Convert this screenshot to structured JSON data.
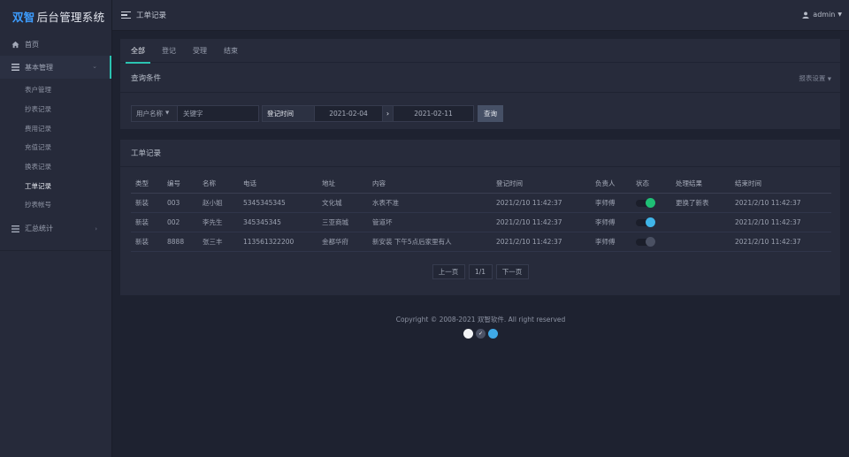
{
  "app": {
    "brand": "双智",
    "title_rest": "后台管理系统"
  },
  "sidebar": {
    "home": {
      "label": "首页",
      "icon": "home-icon"
    },
    "basic": {
      "label": "基本管理",
      "icon": "list-icon"
    },
    "sub_items": [
      {
        "label": "表户管理",
        "active": false
      },
      {
        "label": "抄表记录",
        "active": false
      },
      {
        "label": "费用记录",
        "active": false
      },
      {
        "label": "充值记录",
        "active": false
      },
      {
        "label": "换表记录",
        "active": false
      },
      {
        "label": "工单记录",
        "active": true
      },
      {
        "label": "抄表帐号",
        "active": false
      }
    ],
    "summary": {
      "label": "汇总统计",
      "icon": "list-icon"
    }
  },
  "topbar": {
    "breadcrumb": "工单记录",
    "user": "admin"
  },
  "tabs": [
    "全部",
    "登记",
    "受理",
    "结束"
  ],
  "query": {
    "title": "查询条件",
    "report_settings": "报表设置",
    "field_select": "用户名称",
    "keyword_placeholder": "关键字",
    "date_label": "登记时间",
    "date_from": "2021-02-04",
    "date_sep": "›",
    "date_to": "2021-02-11",
    "search_button": "查询"
  },
  "list": {
    "title": "工单记录",
    "columns": [
      "类型",
      "编号",
      "名称",
      "电话",
      "地址",
      "内容",
      "登记时间",
      "负责人",
      "状态",
      "处理结果",
      "结束时间"
    ],
    "rows": [
      {
        "type": "新装",
        "id": "003",
        "name": "赵小姐",
        "phone": "5345345345",
        "address": "文化城",
        "content": "水表不准",
        "reg_time": "2021/2/10 11:42:37",
        "owner": "李师傅",
        "status_color": "#1fbf75",
        "result": "更换了新表",
        "end_time": "2021/2/10 11:42:37"
      },
      {
        "type": "新装",
        "id": "002",
        "name": "李先生",
        "phone": "345345345",
        "address": "三亚商城",
        "content": "管道坏",
        "reg_time": "2021/2/10 11:42:37",
        "owner": "李师傅",
        "status_color": "#3fb5e8",
        "result": "",
        "end_time": "2021/2/10 11:42:37"
      },
      {
        "type": "新装",
        "id": "8888",
        "name": "张三丰",
        "phone": "113561322200",
        "address": "金都华府",
        "content": "新安装 下午5点后家里有人",
        "reg_time": "2021/2/10 11:42:37",
        "owner": "李师傅",
        "status_color": "#4a5062",
        "result": "",
        "end_time": "2021/2/10 11:42:37"
      }
    ]
  },
  "pager": {
    "prev": "上一页",
    "page": "1/1",
    "next": "下一页"
  },
  "footer": {
    "copyright": "Copyright © 2008-2021 双智软件. All right reserved"
  },
  "theme_dots": [
    "#f2f3f5",
    "#4b5164",
    "#3fa9e6"
  ]
}
